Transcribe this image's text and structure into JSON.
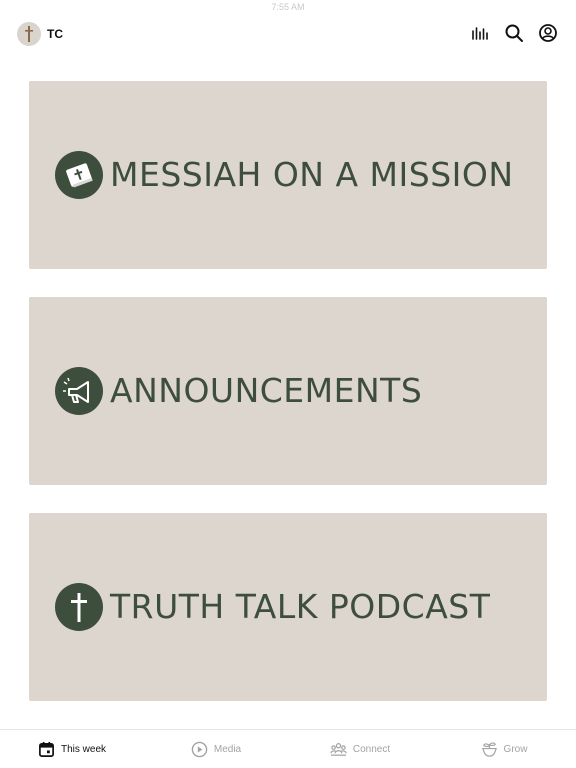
{
  "status_bar": {
    "time": "7:55 AM"
  },
  "header": {
    "app_title": "TC",
    "icons": [
      "bar-chart-icon",
      "search-icon",
      "account-icon"
    ]
  },
  "cards": [
    {
      "title": "MESSIAH ON A MISSION",
      "icon": "bible-icon"
    },
    {
      "title": "ANNOUNCEMENTS",
      "icon": "megaphone-icon"
    },
    {
      "title": "TRUTH TALK PODCAST",
      "icon": "cross-icon"
    }
  ],
  "tabs": [
    {
      "label": "This week",
      "icon": "calendar-icon",
      "active": true
    },
    {
      "label": "Media",
      "icon": "play-icon",
      "active": false
    },
    {
      "label": "Connect",
      "icon": "people-icon",
      "active": false
    },
    {
      "label": "Grow",
      "icon": "sprout-icon",
      "active": false
    }
  ],
  "colors": {
    "card_bg": "#ddd6cf",
    "brand_green": "#3e4e3d",
    "tab_active": "#111111",
    "tab_inactive": "#a3a3a3"
  }
}
